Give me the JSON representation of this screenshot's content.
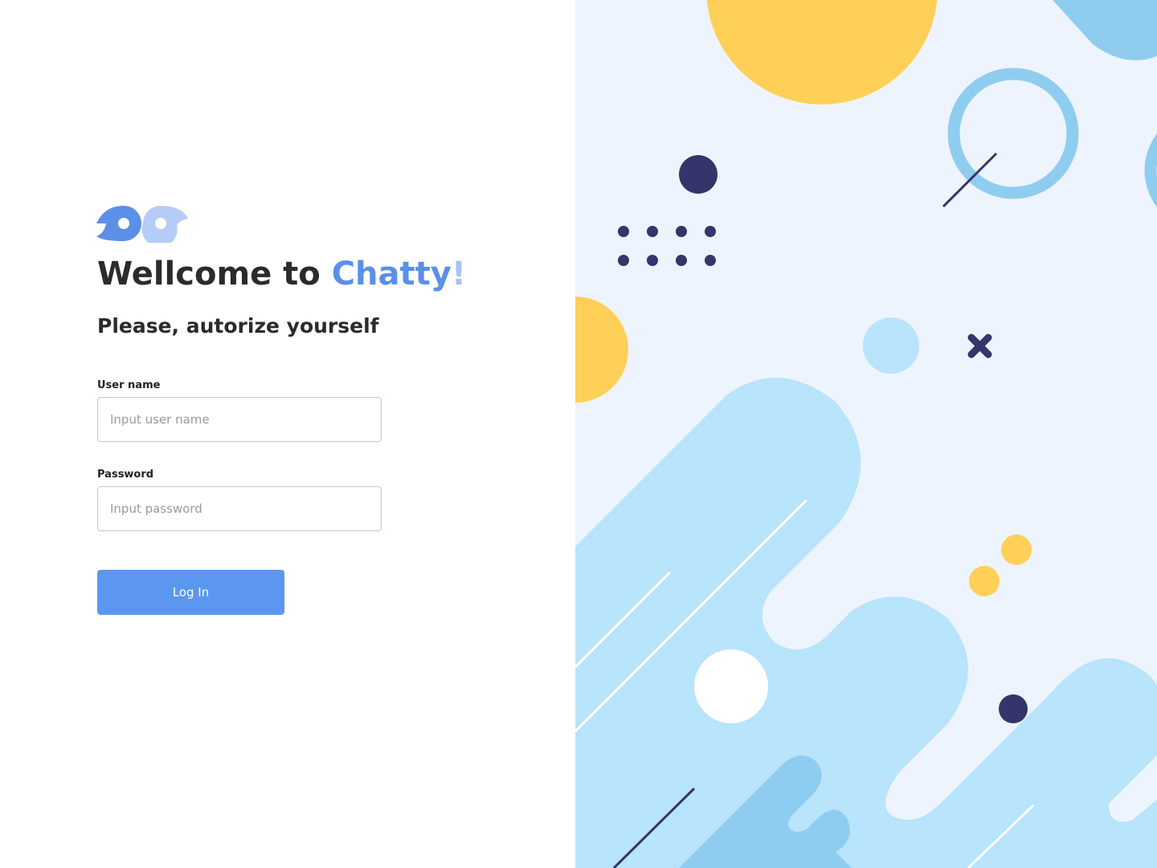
{
  "login": {
    "title_prefix": "Wellcome to ",
    "title_brand": "Chatty",
    "title_bang": "!",
    "subtitle": "Please, autorize yourself",
    "username_label": "User name",
    "username_placeholder": "Input user name",
    "username_value": "",
    "password_label": "Password",
    "password_placeholder": "Input password",
    "password_value": "",
    "login_button": "Log In"
  },
  "colors": {
    "brand_blue": "#5b8fe8",
    "brand_light_blue": "#a8c3f2",
    "button_blue": "#5b97f0",
    "illustration_bg": "#eef4fd",
    "illustration_light_blue": "#b8e4fc",
    "illustration_mid_blue": "#8fcdf0",
    "illustration_yellow": "#ffd057",
    "illustration_navy": "#33356b"
  },
  "icons": {
    "logo": "chatty-logo-icon"
  }
}
